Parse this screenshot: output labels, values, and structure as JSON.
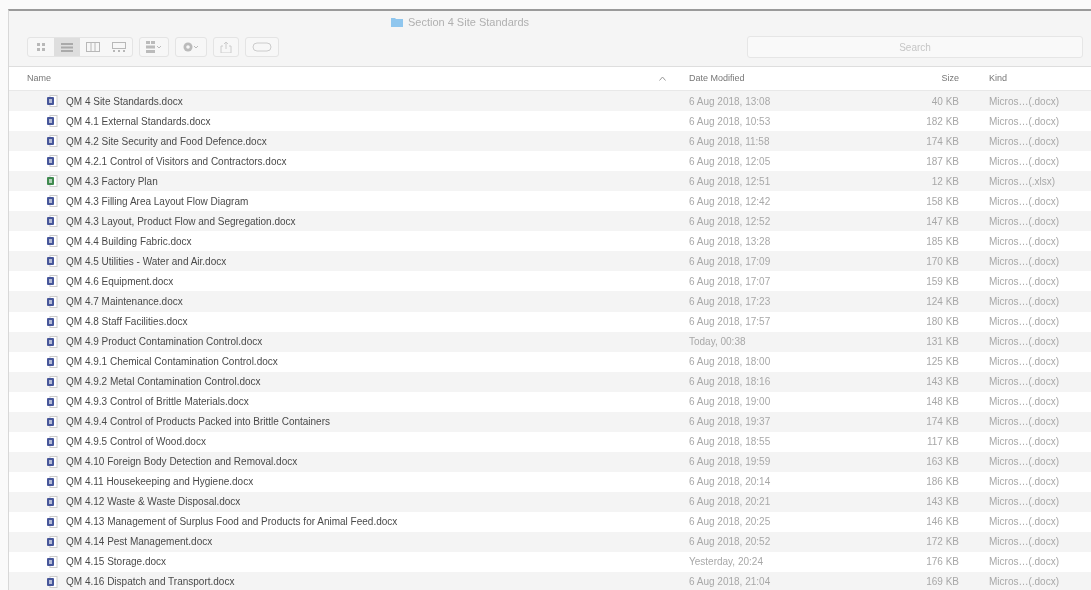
{
  "window": {
    "title": "Section 4 Site Standards"
  },
  "toolbar": {
    "view_buttons": [
      {
        "kind": "icons",
        "selected": false
      },
      {
        "kind": "list",
        "selected": true
      },
      {
        "kind": "columns",
        "selected": false
      },
      {
        "kind": "gallery",
        "selected": false
      }
    ]
  },
  "search": {
    "placeholder": "Search"
  },
  "table": {
    "columns": [
      "Name",
      "Date Modified",
      "Size",
      "Kind"
    ],
    "rows": [
      {
        "kind": "docx",
        "name": "QM 4 Site Standards.docx",
        "date": "6 Aug 2018, 13:08",
        "size": "40 KB",
        "file_kind": "Micros…(.docx)"
      },
      {
        "kind": "docx",
        "name": "QM 4.1 External Standards.docx",
        "date": "6 Aug 2018, 10:53",
        "size": "182 KB",
        "file_kind": "Micros…(.docx)"
      },
      {
        "kind": "docx",
        "name": "QM 4.2 Site Security and Food Defence.docx",
        "date": "6 Aug 2018, 11:58",
        "size": "174 KB",
        "file_kind": "Micros…(.docx)"
      },
      {
        "kind": "docx",
        "name": "QM 4.2.1 Control of Visitors and Contractors.docx",
        "date": "6 Aug 2018, 12:05",
        "size": "187 KB",
        "file_kind": "Micros…(.docx)"
      },
      {
        "kind": "xlsx",
        "name": "QM 4.3 Factory Plan",
        "date": "6 Aug 2018, 12:51",
        "size": "12 KB",
        "file_kind": "Micros…(.xlsx)"
      },
      {
        "kind": "docx",
        "name": "QM 4.3 Filling Area Layout Flow Diagram",
        "date": "6 Aug 2018, 12:42",
        "size": "158 KB",
        "file_kind": "Micros…(.docx)"
      },
      {
        "kind": "docx",
        "name": "QM 4.3 Layout, Product Flow and Segregation.docx",
        "date": "6 Aug 2018, 12:52",
        "size": "147 KB",
        "file_kind": "Micros…(.docx)"
      },
      {
        "kind": "docx",
        "name": "QM 4.4 Building Fabric.docx",
        "date": "6 Aug 2018, 13:28",
        "size": "185 KB",
        "file_kind": "Micros…(.docx)"
      },
      {
        "kind": "docx",
        "name": "QM 4.5 Utilities - Water and Air.docx",
        "date": "6 Aug 2018, 17:09",
        "size": "170 KB",
        "file_kind": "Micros…(.docx)"
      },
      {
        "kind": "docx",
        "name": "QM 4.6 Equipment.docx",
        "date": "6 Aug 2018, 17:07",
        "size": "159 KB",
        "file_kind": "Micros…(.docx)"
      },
      {
        "kind": "docx",
        "name": "QM 4.7 Maintenance.docx",
        "date": "6 Aug 2018, 17:23",
        "size": "124 KB",
        "file_kind": "Micros…(.docx)"
      },
      {
        "kind": "docx",
        "name": "QM 4.8 Staff Facilities.docx",
        "date": "6 Aug 2018, 17:57",
        "size": "180 KB",
        "file_kind": "Micros…(.docx)"
      },
      {
        "kind": "docx",
        "name": "QM 4.9 Product Contamination Control.docx",
        "date": "Today, 00:38",
        "size": "131 KB",
        "file_kind": "Micros…(.docx)"
      },
      {
        "kind": "docx",
        "name": "QM 4.9.1 Chemical Contamination Control.docx",
        "date": "6 Aug 2018, 18:00",
        "size": "125 KB",
        "file_kind": "Micros…(.docx)"
      },
      {
        "kind": "docx",
        "name": "QM 4.9.2 Metal Contamination Control.docx",
        "date": "6 Aug 2018, 18:16",
        "size": "143 KB",
        "file_kind": "Micros…(.docx)"
      },
      {
        "kind": "docx",
        "name": "QM 4.9.3 Control of Brittle Materials.docx",
        "date": "6 Aug 2018, 19:00",
        "size": "148 KB",
        "file_kind": "Micros…(.docx)"
      },
      {
        "kind": "docx",
        "name": "QM 4.9.4 Control of Products Packed into Brittle Containers",
        "date": "6 Aug 2018, 19:37",
        "size": "174 KB",
        "file_kind": "Micros…(.docx)"
      },
      {
        "kind": "docx",
        "name": "QM 4.9.5 Control of Wood.docx",
        "date": "6 Aug 2018, 18:55",
        "size": "117 KB",
        "file_kind": "Micros…(.docx)"
      },
      {
        "kind": "docx",
        "name": "QM 4.10 Foreign Body Detection and Removal.docx",
        "date": "6 Aug 2018, 19:59",
        "size": "163 KB",
        "file_kind": "Micros…(.docx)"
      },
      {
        "kind": "docx",
        "name": "QM 4.11 Housekeeping and Hygiene.docx",
        "date": "6 Aug 2018, 20:14",
        "size": "186 KB",
        "file_kind": "Micros…(.docx)"
      },
      {
        "kind": "docx",
        "name": "QM 4.12 Waste & Waste Disposal.docx",
        "date": "6 Aug 2018, 20:21",
        "size": "143 KB",
        "file_kind": "Micros…(.docx)"
      },
      {
        "kind": "docx",
        "name": "QM 4.13 Management of Surplus Food and Products for Animal Feed.docx",
        "date": "6 Aug 2018, 20:25",
        "size": "146 KB",
        "file_kind": "Micros…(.docx)"
      },
      {
        "kind": "docx",
        "name": "QM 4.14 Pest Management.docx",
        "date": "6 Aug 2018, 20:52",
        "size": "172 KB",
        "file_kind": "Micros…(.docx)"
      },
      {
        "kind": "docx",
        "name": "QM 4.15 Storage.docx",
        "date": "Yesterday, 20:24",
        "size": "176 KB",
        "file_kind": "Micros…(.docx)"
      },
      {
        "kind": "docx",
        "name": "QM 4.16 Dispatch and Transport.docx",
        "date": "6 Aug 2018, 21:04",
        "size": "169 KB",
        "file_kind": "Micros…(.docx)"
      }
    ]
  }
}
